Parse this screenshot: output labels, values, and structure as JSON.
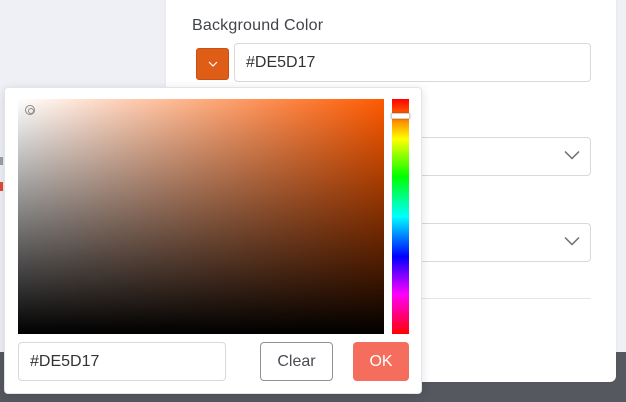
{
  "form": {
    "background_color_label": "Background Color",
    "background_color_value": "#DE5D17"
  },
  "color_picker": {
    "hex_value": "#DE5D17",
    "clear_label": "Clear",
    "ok_label": "OK",
    "hue_fraction": 0.06
  },
  "colors": {
    "selected": "#DE5D17",
    "hue_base": "#FF5A00",
    "ok_button": "#F56D5C",
    "dark_strip": "#55585F"
  },
  "icons": {
    "swatch_toggle": "chevron-down-icon",
    "select_toggle": "chevron-down-icon"
  }
}
